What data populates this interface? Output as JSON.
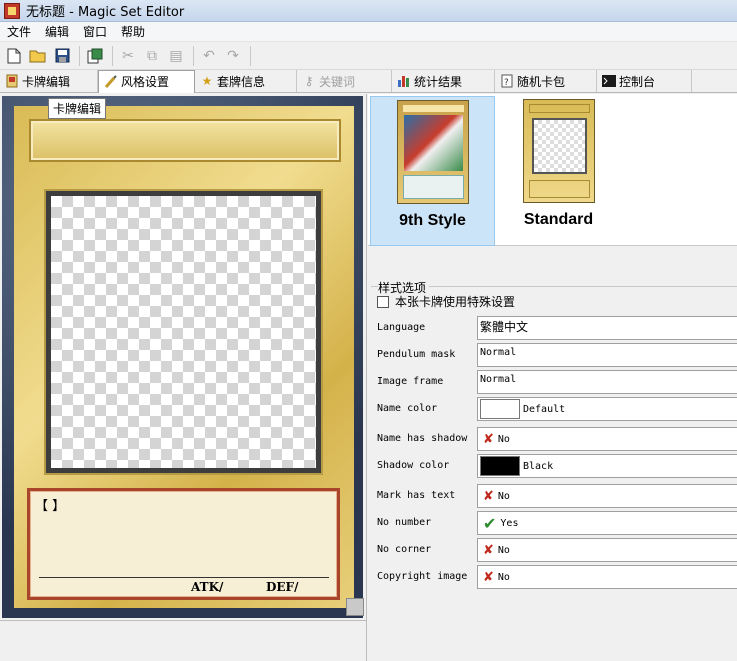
{
  "window": {
    "title": "无标题 - Magic Set Editor"
  },
  "menu": {
    "items": [
      "文件",
      "编辑",
      "窗口",
      "帮助"
    ]
  },
  "tabs": [
    {
      "label": "卡牌编辑",
      "icon": "card-edit-icon"
    },
    {
      "label": "风格设置",
      "icon": "brush-icon"
    },
    {
      "label": "套牌信息",
      "icon": "star-icon"
    },
    {
      "label": "关键词",
      "icon": "key-icon"
    },
    {
      "label": "统计结果",
      "icon": "bar-chart-icon"
    },
    {
      "label": "随机卡包",
      "icon": "random-pack-icon"
    },
    {
      "label": "控制台",
      "icon": "console-icon"
    }
  ],
  "tooltip": "卡牌编辑",
  "card": {
    "text_brackets": "【  】",
    "atk_label": "ATK/",
    "def_label": "DEF/"
  },
  "styles": [
    {
      "label": "9th Style",
      "selected": true
    },
    {
      "label": "Standard",
      "selected": false
    }
  ],
  "style_options": {
    "group_label": "样式选项",
    "special_checkbox_label": "本张卡牌使用特殊设置",
    "rows": [
      {
        "label": "Language",
        "value": "繁體中文"
      },
      {
        "label": "Pendulum mask",
        "value": "Normal"
      },
      {
        "label": "Image frame",
        "value": "Normal"
      },
      {
        "label": "Name color",
        "value": "Default",
        "swatch": "#ffffff"
      },
      {
        "label": "Name has shadow",
        "value": "No",
        "icon": "x-icon"
      },
      {
        "label": "Shadow color",
        "value": "Black",
        "swatch": "#000000"
      },
      {
        "label": "Mark has text",
        "value": "No",
        "icon": "x-icon"
      },
      {
        "label": "No number",
        "value": "Yes",
        "icon": "check-icon"
      },
      {
        "label": "No corner",
        "value": "No",
        "icon": "x-icon"
      },
      {
        "label": "Copyright image",
        "value": "No",
        "icon": "x-icon"
      }
    ]
  }
}
